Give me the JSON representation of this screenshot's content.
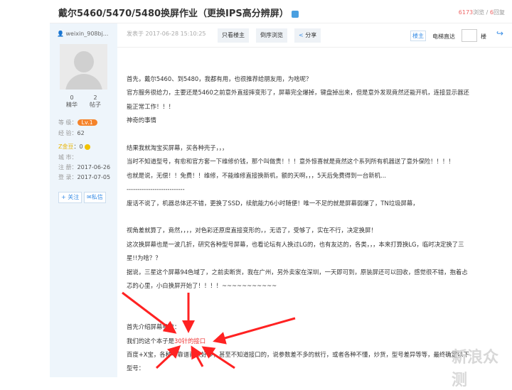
{
  "title": "戴尔5460/5470/5480换屏作业（更换IPS高分辨屏）",
  "stats": {
    "views": "6173",
    "views_label": "浏览 / ",
    "replies": "6",
    "replies_label": "回复"
  },
  "user": {
    "name": "weixin_908bj...",
    "posts": "0",
    "posts_label": "精华",
    "threads": "2",
    "threads_label": "帖子",
    "level_label": "等 级：",
    "level": "Lv.1",
    "exp_label": "经 验：",
    "exp": "62",
    "coin_label": "Z金豆",
    "coin": "：0",
    "city_label": "城 市：",
    "city": "",
    "reg_label": "注 册：",
    "reg": "2017-06-26",
    "login_label": "登 录：",
    "login": "2017-07-05",
    "follow": "+ 关注",
    "message": "私信"
  },
  "toolbar": {
    "posted": "发表于 2017-06-28 15:10:25",
    "only_owner": "只看楼主",
    "reverse": "倒序浏览",
    "share": "分享",
    "owner_tag": "楼主",
    "lift": "电梯直达",
    "floor_suffix": "楼"
  },
  "content": {
    "lines": [
      "首先，戴尔5460、到5480，我都有用，也很推荐给朋友用，为啥呢？",
      "官方服务很给力，主要还是5460之前意外直接摔变形了，屏幕完全爆掉，键盘掉出来，但是意外发现竟然还能开机，连接显示器还",
      "能正常工作！！！",
      "神奇的事情",
      "",
      "结果我就淘宝买屏幕，买各种壳子，，，",
      "当时不知道型号，有愈和官方套一下维修价钱，那个叫做贵！！！意外惊喜就是竟然这个系列所有机器送了意外保险！！！！",
      "也就是说，无偿！！免费！！维修，不能维修直接换新机，额的天啊，，，5天后免费得到一台新机...",
      "---------------------------",
      "废话不说了，机器总体还不错，更换了SSD，续航能力6小时随便！唯一不足的就是屏幕弱爆了，TN垃圾屏幕，",
      "",
      "视角差就算了，竟然，，，，对色彩还原度直接变形的，，无语了，受够了，实在不行，决定换屏！",
      "这次换屏幕也是一波几折，研究各种型号屏幕，也看论坛有人换过LG的，也有友达的，各类，，，本来打算换LG，临时决定换了三",
      "星!!为啥？？",
      "据说，三星这个屏幕94色域了，之前卖断货，我在广州，另外卖家在深圳，一天即可到，原装屏还可以回收，感觉很不错，抱着忐",
      "忑的心里，小白换屏开始了！！！！~~~~~~~~~~~",
      "",
      "",
      "首先介绍屏幕参数："
    ],
    "interface_prefix": "我们的这个本子是",
    "interface_highlight": "30针的接口",
    "after": [
      "百度+X宝，各种不靠谱商家好多，甚至不知道接口的，说参数差不多的就行，或者各种不懂，炒货，型号差异等等，最终确定以下",
      "型号："
    ]
  },
  "watermark": "新浪众测"
}
